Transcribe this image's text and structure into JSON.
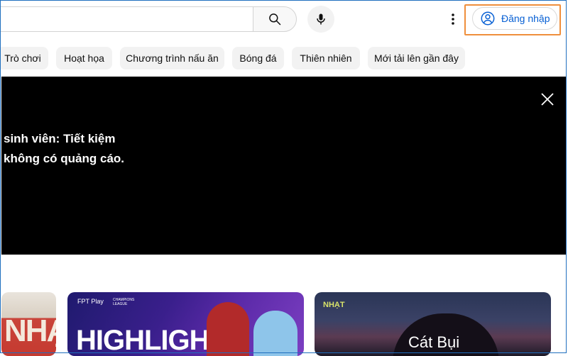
{
  "header": {
    "search_placeholder": "",
    "signin_label": "Đăng nhập",
    "icons": [
      "search-icon",
      "mic-icon",
      "more-vert-icon",
      "account-circle-icon"
    ]
  },
  "chips": [
    {
      "label": "Trò chơi"
    },
    {
      "label": "Hoạt họa"
    },
    {
      "label": "Chương trình nấu ăn"
    },
    {
      "label": "Bóng đá"
    },
    {
      "label": "Thiên nhiên"
    },
    {
      "label": "Mới tải lên gần đây"
    }
  ],
  "banner": {
    "line1": "sinh viên: Tiết kiệm",
    "line2": "không có quảng cáo."
  },
  "thumbnails": [
    {
      "text": "NHẠC"
    },
    {
      "brand": "FPT Play",
      "sub": "CHAMPIONS LEAGUE",
      "title": "HIGHLIGHTS"
    },
    {
      "brand": "NHẠT",
      "title": "Cát Bụi"
    }
  ],
  "colors": {
    "accent": "#065fd4",
    "highlight_border": "#ef8f3c",
    "chip_bg": "#f2f2f2",
    "banner_bg": "#000000"
  }
}
